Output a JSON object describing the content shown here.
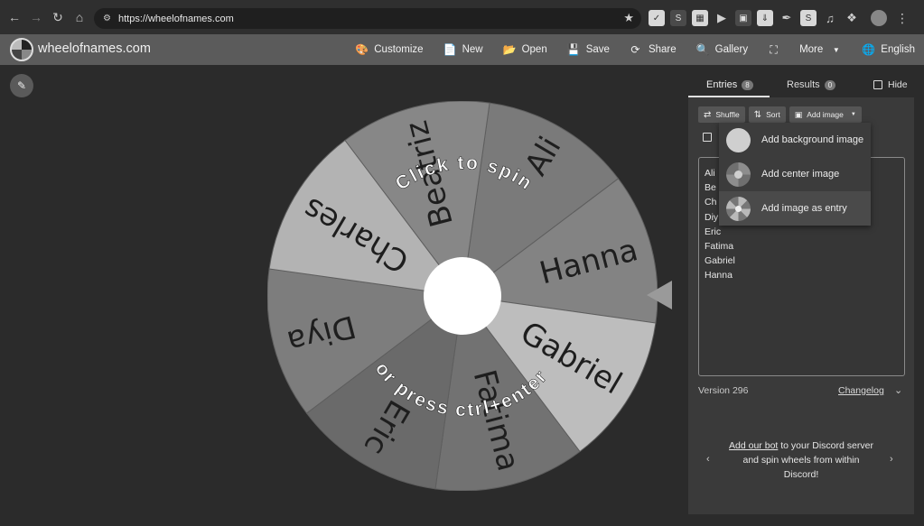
{
  "browser": {
    "url": "https://wheelofnames.com",
    "extensions": [
      "S",
      "S"
    ]
  },
  "header": {
    "logo_text": "wheelofnames.com",
    "menu": {
      "customize": "Customize",
      "new": "New",
      "open": "Open",
      "save": "Save",
      "share": "Share",
      "gallery": "Gallery",
      "more": "More",
      "language": "English"
    }
  },
  "wheel": {
    "slices": [
      {
        "name": "Ali",
        "color": "#7a7a7a"
      },
      {
        "name": "Hanna",
        "color": "#838383"
      },
      {
        "name": "Gabriel",
        "color": "#bdbdbd"
      },
      {
        "name": "Fatima",
        "color": "#727272"
      },
      {
        "name": "Eric",
        "color": "#6a6a6a"
      },
      {
        "name": "Diya",
        "color": "#7d7d7d"
      },
      {
        "name": "Charles",
        "color": "#b3b3b3"
      },
      {
        "name": "Beatriz",
        "color": "#878787"
      }
    ],
    "overlay_top": "Click to spin",
    "overlay_bottom": "or press ctrl+enter"
  },
  "panel": {
    "tabs": {
      "entries": {
        "label": "Entries",
        "count": "8"
      },
      "results": {
        "label": "Results",
        "count": "0"
      }
    },
    "hide_label": "Hide",
    "toolbar": {
      "shuffle": "Shuffle",
      "sort": "Sort",
      "add_image": "Add image"
    },
    "entries_visible": [
      "Ali",
      "Be",
      "Ch",
      "Diy",
      "Eric",
      "Fatima",
      "Gabriel",
      "Hanna"
    ],
    "dropdown": {
      "background": "Add background image",
      "center": "Add center image",
      "as_entry": "Add image as entry"
    },
    "version": "Version 296",
    "changelog": "Changelog",
    "discord": {
      "link": "Add our bot",
      "text_1": " to your Discord server",
      "text_2": "and spin wheels from within",
      "text_3": "Discord!"
    }
  }
}
